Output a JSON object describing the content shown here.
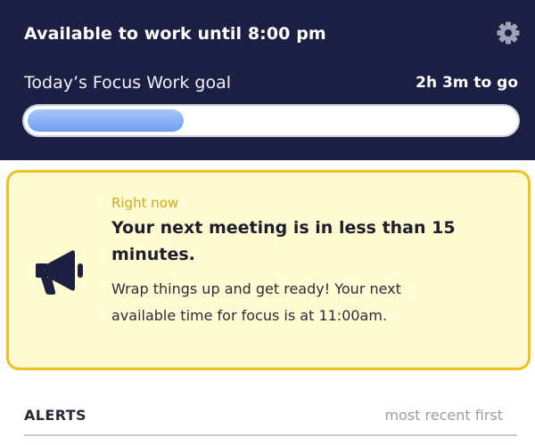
{
  "header": {
    "availability": "Available to work until 8:00 pm",
    "settings_icon": "gear-icon",
    "goal_label": "Today’s Focus Work goal",
    "goal_remaining": "2h 3m to go",
    "goal_progress_fraction": 0.32,
    "background_color": "#1b1f44",
    "progress_color": "#6f9ef0"
  },
  "alert_card": {
    "eyebrow": "Right now",
    "title": "Your next meeting is in less than 15 minutes.",
    "body": "Wrap things up and get ready! Your next available time for focus is at 11:00am.",
    "icon": "megaphone-icon",
    "background_color": "#fffbd3",
    "border_color": "#f0c21b"
  },
  "alerts": {
    "heading": "ALERTS",
    "sort_label": "most recent first"
  }
}
